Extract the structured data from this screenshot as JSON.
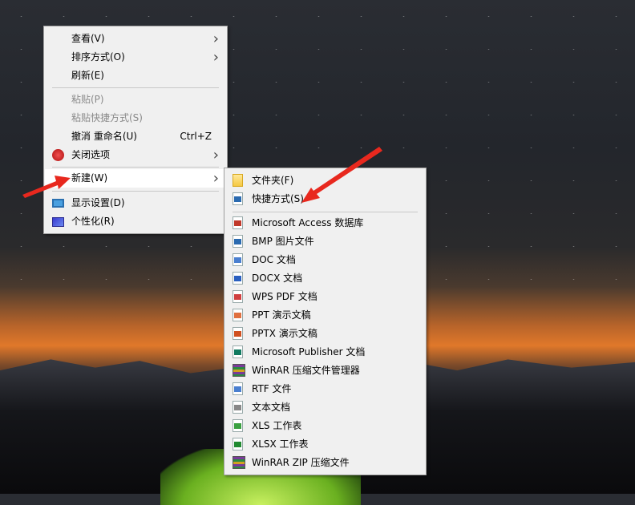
{
  "context_menu": {
    "items": [
      {
        "label": "查看(V)",
        "submenu": true
      },
      {
        "label": "排序方式(O)",
        "submenu": true
      },
      {
        "label": "刷新(E)"
      },
      {
        "label": "粘贴(P)",
        "disabled": true
      },
      {
        "label": "粘贴快捷方式(S)",
        "disabled": true
      },
      {
        "label": "撤消 重命名(U)",
        "shortcut": "Ctrl+Z"
      },
      {
        "label": "关闭选项",
        "submenu": true,
        "icon": "power-icon"
      },
      {
        "label": "新建(W)",
        "submenu": true,
        "highlighted": true
      },
      {
        "label": "显示设置(D)",
        "icon": "display-icon"
      },
      {
        "label": "个性化(R)",
        "icon": "personalize-icon"
      }
    ]
  },
  "new_submenu": {
    "items": [
      {
        "label": "文件夹(F)",
        "icon": "folder-icon"
      },
      {
        "label": "快捷方式(S)",
        "icon": "shortcut-icon"
      },
      {
        "label": "Microsoft Access 数据库",
        "icon": "access-icon",
        "color": "#c0392b"
      },
      {
        "label": "BMP 图片文件",
        "icon": "bmp-icon",
        "color": "#2a6ab0"
      },
      {
        "label": "DOC 文档",
        "icon": "doc-icon",
        "color": "#4a7fd0"
      },
      {
        "label": "DOCX 文档",
        "icon": "docx-icon",
        "color": "#2a5fc0"
      },
      {
        "label": "WPS PDF 文档",
        "icon": "pdf-icon",
        "color": "#d04040"
      },
      {
        "label": "PPT 演示文稿",
        "icon": "ppt-icon",
        "color": "#e07040"
      },
      {
        "label": "PPTX 演示文稿",
        "icon": "pptx-icon",
        "color": "#d05020"
      },
      {
        "label": "Microsoft Publisher 文档",
        "icon": "publisher-icon",
        "color": "#107a60"
      },
      {
        "label": "WinRAR 压缩文件管理器",
        "icon": "winrar-icon",
        "color": "#7a3a9a"
      },
      {
        "label": "RTF 文件",
        "icon": "rtf-icon",
        "color": "#4a7fd0"
      },
      {
        "label": "文本文档",
        "icon": "txt-icon",
        "color": "#888888"
      },
      {
        "label": "XLS 工作表",
        "icon": "xls-icon",
        "color": "#3aa040"
      },
      {
        "label": "XLSX 工作表",
        "icon": "xlsx-icon",
        "color": "#208a30"
      },
      {
        "label": "WinRAR ZIP 压缩文件",
        "icon": "winrar-zip-icon",
        "color": "#7a3a9a"
      }
    ]
  },
  "colors": {
    "arrow": "#e8281e",
    "menu_bg": "#f0f0f0"
  }
}
